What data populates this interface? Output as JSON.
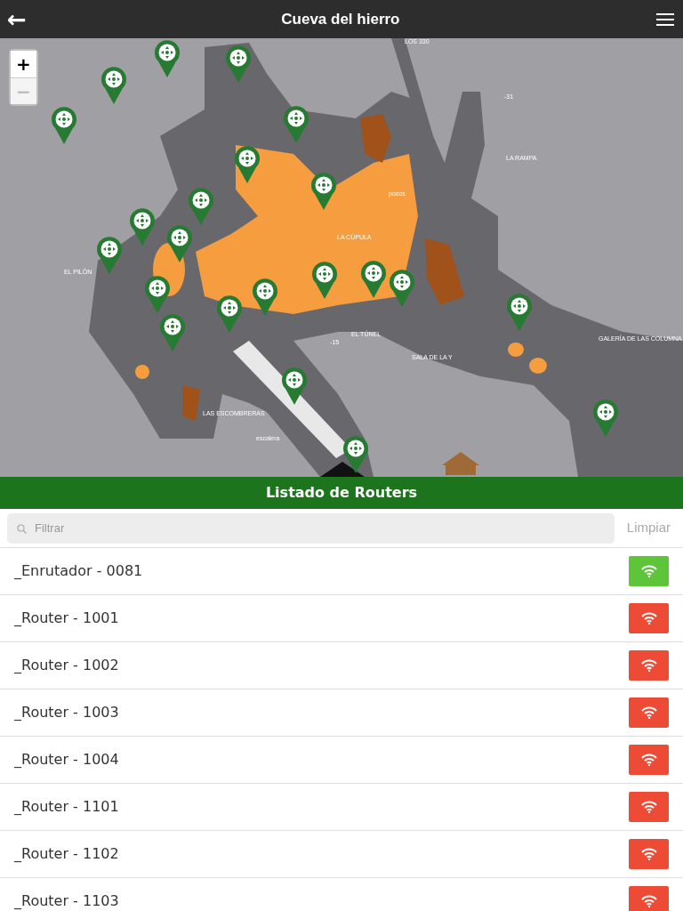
{
  "header": {
    "title": "Cueva del hierro",
    "back_icon": "←"
  },
  "map": {
    "zoom_in": {
      "label": "+",
      "disabled": false
    },
    "zoom_out": {
      "label": "−",
      "disabled": true
    },
    "labels": [
      "LOS 330",
      "-31",
      "LA RAMPA",
      "pozos",
      "LA CÚPULA",
      "EL PILÓN",
      "EL TÚNEL",
      "-15",
      "SALA DE LA Y",
      "GALERÍA DE LAS COLUMNA",
      "LAS ESCOMBRERAS",
      "escalera"
    ]
  },
  "list_title": "Listado de Routers",
  "filter": {
    "placeholder": "Filtrar",
    "clear": "Limpiar"
  },
  "routers": [
    {
      "name": "_Enrutador - 0081",
      "connected": true
    },
    {
      "name": "_Router - 1001",
      "connected": false
    },
    {
      "name": "_Router - 1002",
      "connected": false
    },
    {
      "name": "_Router - 1003",
      "connected": false
    },
    {
      "name": "_Router - 1004",
      "connected": false
    },
    {
      "name": "_Router - 1101",
      "connected": false
    },
    {
      "name": "_Router - 1102",
      "connected": false
    },
    {
      "name": "_Router - 1103",
      "connected": false
    }
  ]
}
